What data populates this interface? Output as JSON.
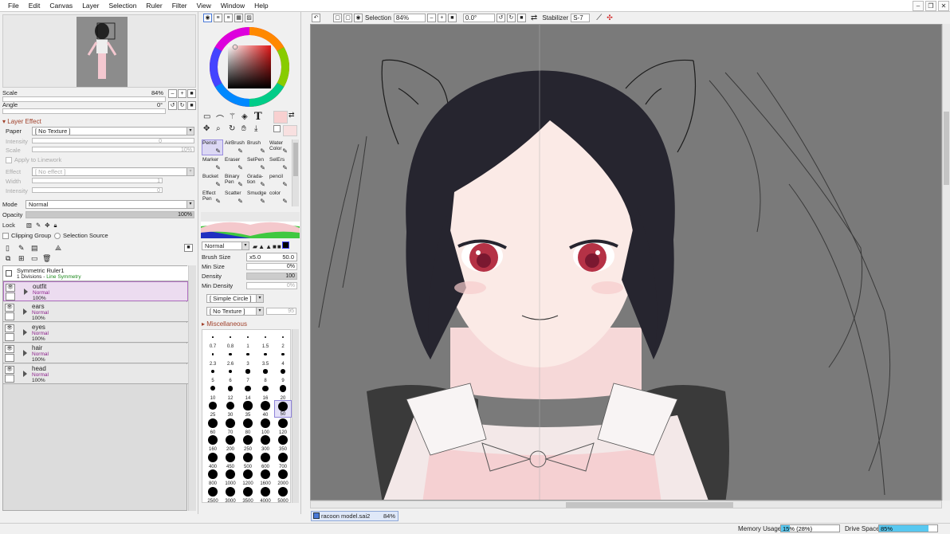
{
  "menu": [
    "File",
    "Edit",
    "Canvas",
    "Layer",
    "Selection",
    "Ruler",
    "Filter",
    "View",
    "Window",
    "Help"
  ],
  "navigator": {
    "scale_label": "Scale",
    "scale_value": "84%",
    "angle_label": "Angle",
    "angle_value": "0°"
  },
  "layer_effect": {
    "title": "Layer Effect",
    "paper_label": "Paper",
    "paper_value": "[ No Texture ]",
    "intensity_label": "Intensity",
    "intensity_value": "0",
    "scale_label": "Scale",
    "scale_value": "10%",
    "apply_linework": "Apply to Linework",
    "effect_label": "Effect",
    "effect_value": "[ No effect ]",
    "width_label": "Width",
    "width_value": "1",
    "intensity2_label": "Intensity",
    "intensity2_value": "0"
  },
  "mode": {
    "label": "Mode",
    "value": "Normal",
    "opacity_label": "Opacity",
    "opacity_value": "100%",
    "opacity_fraction": 1.0,
    "lock_label": "Lock",
    "clipping_label": "Clipping Group",
    "selection_source_label": "Selection Source"
  },
  "ruler": {
    "name": "Symmetric Ruler1",
    "info_a": "1 Divisions - ",
    "info_b": "Line Symmetry"
  },
  "layers": [
    {
      "name": "outfit",
      "mode": "Normal",
      "opacity": "100%",
      "selected": true
    },
    {
      "name": "ears",
      "mode": "Normal",
      "opacity": "100%",
      "selected": false
    },
    {
      "name": "eyes",
      "mode": "Normal",
      "opacity": "100%",
      "selected": false
    },
    {
      "name": "hair",
      "mode": "Normal",
      "opacity": "100%",
      "selected": false
    },
    {
      "name": "head",
      "mode": "Normal",
      "opacity": "100%",
      "selected": false
    }
  ],
  "tools": [
    {
      "label": "Pencil",
      "selected": true
    },
    {
      "label": "AirBrush",
      "selected": false
    },
    {
      "label": "Brush",
      "selected": false
    },
    {
      "label": "Water Color",
      "selected": false
    },
    {
      "label": "Marker",
      "selected": false
    },
    {
      "label": "Eraser",
      "selected": false
    },
    {
      "label": "SelPen",
      "selected": false
    },
    {
      "label": "SelErs",
      "selected": false
    },
    {
      "label": "Bucket",
      "selected": false
    },
    {
      "label": "Binary Pen",
      "selected": false
    },
    {
      "label": "Grada- tion",
      "selected": false
    },
    {
      "label": "pencil",
      "selected": false
    },
    {
      "label": "Effect Pen",
      "selected": false
    },
    {
      "label": "Scatter",
      "selected": false
    },
    {
      "label": "Smudge",
      "selected": false
    },
    {
      "label": "color",
      "selected": false
    }
  ],
  "brush": {
    "blend_mode": "Normal",
    "size_label": "Brush Size",
    "size_mult": "x5.0",
    "size_value": "50.0",
    "min_size_label": "Min Size",
    "min_size_value": "0%",
    "density_label": "Density",
    "density_value": "100",
    "min_density_label": "Min Density",
    "min_density_value": "0%",
    "shape": "[ Simple Circle ]",
    "texture": "[ No Texture ]",
    "texture_strength": "95",
    "misc_label": "Miscellaneous"
  },
  "sizes": [
    "0.7",
    "0.8",
    "1",
    "1.5",
    "2",
    "2.3",
    "2.6",
    "3",
    "3.5",
    "4",
    "5",
    "6",
    "7",
    "8",
    "9",
    "10",
    "12",
    "14",
    "16",
    "20",
    "25",
    "30",
    "35",
    "40",
    "50",
    "60",
    "70",
    "80",
    "100",
    "120",
    "160",
    "200",
    "250",
    "300",
    "350",
    "400",
    "450",
    "500",
    "600",
    "700",
    "800",
    "1000",
    "1200",
    "1600",
    "2000",
    "2500",
    "3000",
    "3500",
    "4000",
    "5000"
  ],
  "selected_size": "50",
  "toolbar": {
    "selection_label": "Selection",
    "zoom": "84%",
    "angle": "0.0°",
    "stabilizer_label": "Stabilizer",
    "stabilizer_value": "S-7"
  },
  "document": {
    "name": "racoon model.sai2",
    "zoom": "84%"
  },
  "status": {
    "memory_label": "Memory Usage",
    "memory_text": "15% (28%)",
    "memory_fraction": 0.15,
    "drive_label": "Drive Space",
    "drive_text": "85%",
    "drive_fraction": 0.85
  }
}
